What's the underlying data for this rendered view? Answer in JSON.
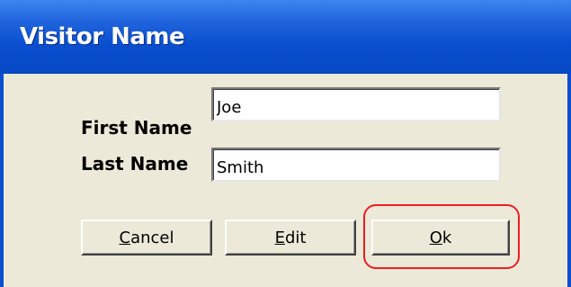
{
  "window": {
    "title": "Visitor Name"
  },
  "form": {
    "first_name_label": "First Name",
    "first_name_value": "Joe",
    "last_name_label": "Last Name",
    "last_name_value": "Smith"
  },
  "buttons": {
    "cancel_prefix": "",
    "cancel_mnemonic": "C",
    "cancel_rest": "ancel",
    "edit_prefix": "",
    "edit_mnemonic": "E",
    "edit_rest": "dit",
    "ok_prefix": "",
    "ok_mnemonic": "O",
    "ok_rest": "k"
  },
  "colors": {
    "titlebar": "#0a4fd0",
    "dialog_face": "#ece9d8",
    "highlight": "#ee1c24"
  }
}
